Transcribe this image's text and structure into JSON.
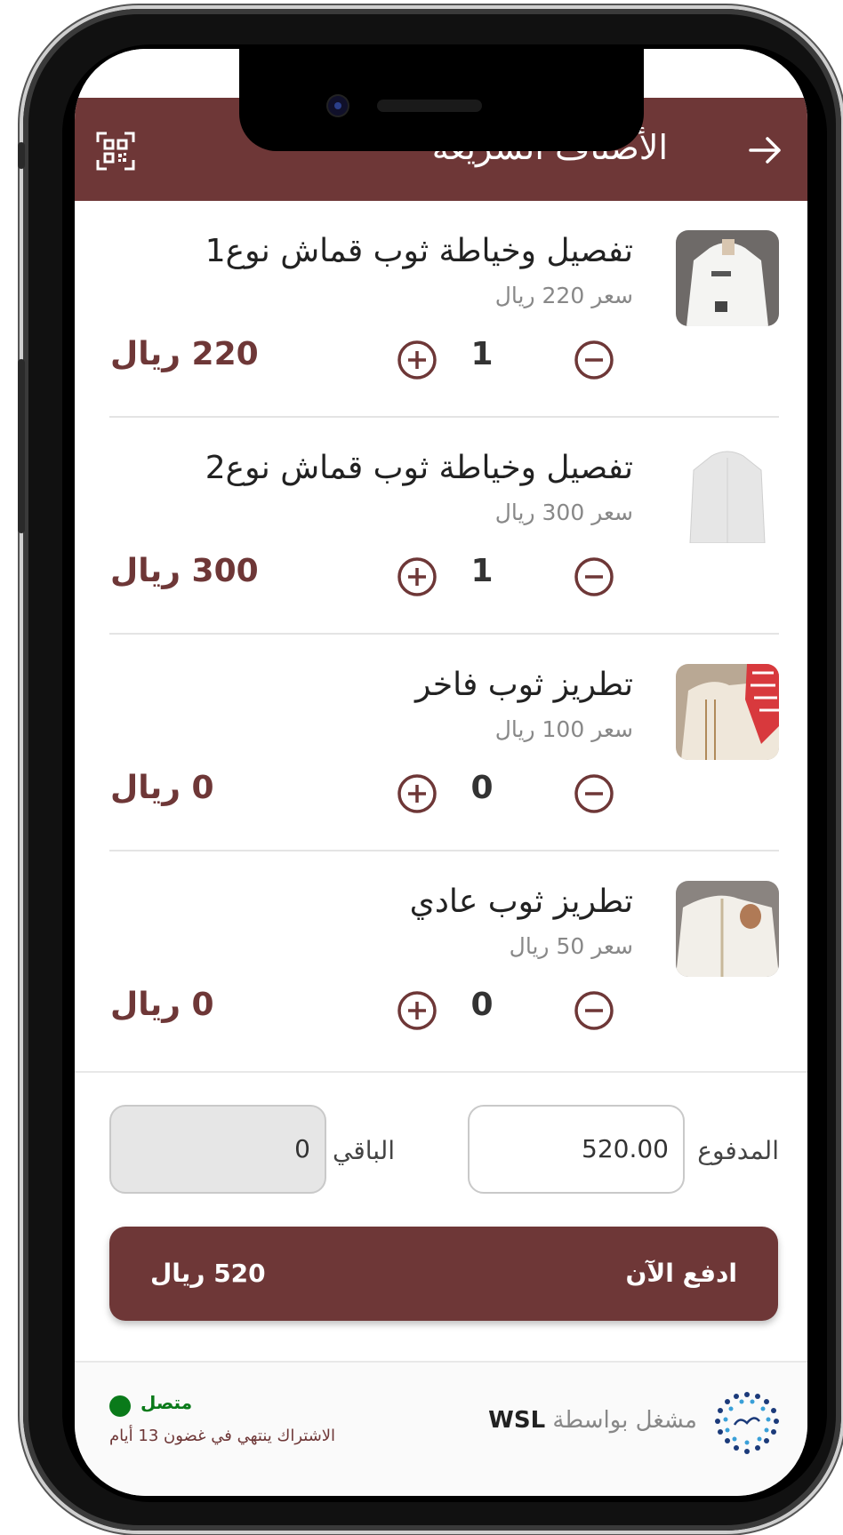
{
  "header": {
    "title": "الأصناف السريعة"
  },
  "items": [
    {
      "name": "تفصيل وخياطة ثوب قماش نوع1",
      "price": "سعر 220 ريال",
      "qty": "1",
      "total": "220 ريال"
    },
    {
      "name": "تفصيل وخياطة ثوب قماش نوع2",
      "price": "سعر 300 ريال",
      "qty": "1",
      "total": "300 ريال"
    },
    {
      "name": "تطريز ثوب فاخر",
      "price": "سعر 100 ريال",
      "qty": "0",
      "total": "0 ريال"
    },
    {
      "name": "تطريز ثوب عادي",
      "price": "سعر 50 ريال",
      "qty": "0",
      "total": "0 ريال"
    }
  ],
  "payment": {
    "paid_label": "المدفوع",
    "paid_value": "520.00",
    "remaining_label": "الباقي",
    "remaining_value": "0"
  },
  "pay_button": {
    "label": "ادفع الآن",
    "amount": "520 ريال"
  },
  "footer": {
    "powered_by": "مشغل بواسطة",
    "brand": "WSL",
    "status": "متصل",
    "subscription": "الاشتراك ينتهي في غضون 13 أيام"
  },
  "colors": {
    "primary": "#6e3737",
    "online": "#0a7a1a"
  }
}
